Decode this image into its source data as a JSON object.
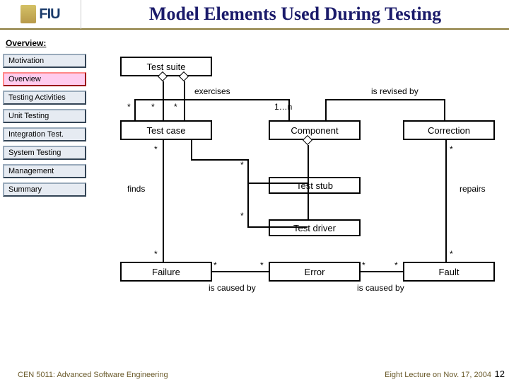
{
  "header": {
    "logo_text": "FIU",
    "title": "Model Elements Used During Testing"
  },
  "sidebar": {
    "section": "Overview:",
    "items": [
      {
        "label": "Motivation",
        "active": false
      },
      {
        "label": "Overview",
        "active": true
      },
      {
        "label": "Testing Activities",
        "active": false
      },
      {
        "label": "Unit Testing",
        "active": false
      },
      {
        "label": "Integration Test.",
        "active": false
      },
      {
        "label": "System Testing",
        "active": false
      },
      {
        "label": "Management",
        "active": false
      },
      {
        "label": "Summary",
        "active": false
      }
    ]
  },
  "diagram": {
    "boxes": {
      "test_suite": "Test suite",
      "test_case": "Test case",
      "component": "Component",
      "correction": "Correction",
      "test_stub": "Test stub",
      "test_driver": "Test driver",
      "failure": "Failure",
      "error": "Error",
      "fault": "Fault"
    },
    "labels": {
      "exercises": "exercises",
      "is_revised_by": "is revised by",
      "finds": "finds",
      "repairs": "repairs",
      "is_caused_by_1": "is caused by",
      "is_caused_by_2": "is caused by"
    },
    "mult": {
      "star": "*",
      "one_n": "1…n"
    }
  },
  "footer": {
    "left": "CEN 5011: Advanced Software Engineering",
    "right": "Eight Lecture on Nov. 17, 2004",
    "page": "12"
  }
}
